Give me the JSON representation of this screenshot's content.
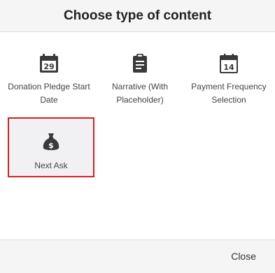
{
  "dialog": {
    "title": "Choose type of content",
    "close_label": "Close"
  },
  "tiles": [
    {
      "label": "Donation Pledge Start Date",
      "icon": "calendar-29-icon",
      "icon_text": "29",
      "selected": false
    },
    {
      "label": "Narrative (With Placeholder)",
      "icon": "clipboard-icon",
      "selected": false
    },
    {
      "label": "Payment Frequency Selection",
      "icon": "calendar-14-icon",
      "icon_text": "14",
      "selected": false
    },
    {
      "label": "Next Ask",
      "icon": "money-bag-icon",
      "selected": true
    }
  ],
  "colors": {
    "selected_border": "#d62020",
    "icon": "#3a3a3a"
  }
}
